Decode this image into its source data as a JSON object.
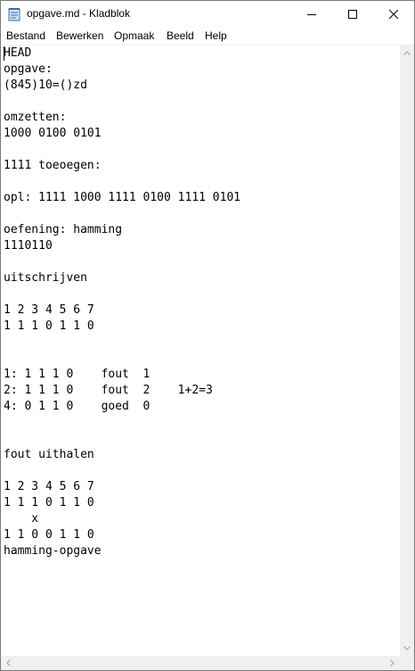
{
  "window": {
    "title": "opgave.md - Kladblok"
  },
  "menu": {
    "items": [
      "Bestand",
      "Bewerken",
      "Opmaak",
      "Beeld",
      "Help"
    ]
  },
  "document": {
    "lines": [
      "HEAD",
      "opgave:",
      "(845)10=()zd",
      "",
      "omzetten:",
      "1000 0100 0101",
      "",
      "1111 toeoegen:",
      "",
      "opl: 1111 1000 1111 0100 1111 0101",
      "",
      "oefening: hamming",
      "1110110",
      "",
      "uitschrijven",
      "",
      "1 2 3 4 5 6 7",
      "1 1 1 0 1 1 0",
      "",
      "",
      "1: 1 1 1 0    fout  1",
      "2: 1 1 1 0    fout  2    1+2=3",
      "4: 0 1 1 0    goed  0",
      "",
      "",
      "fout uithalen",
      "",
      "1 2 3 4 5 6 7",
      "1 1 1 0 1 1 0",
      "    x",
      "1 1 0 0 1 1 0",
      "hamming-opgave"
    ]
  }
}
